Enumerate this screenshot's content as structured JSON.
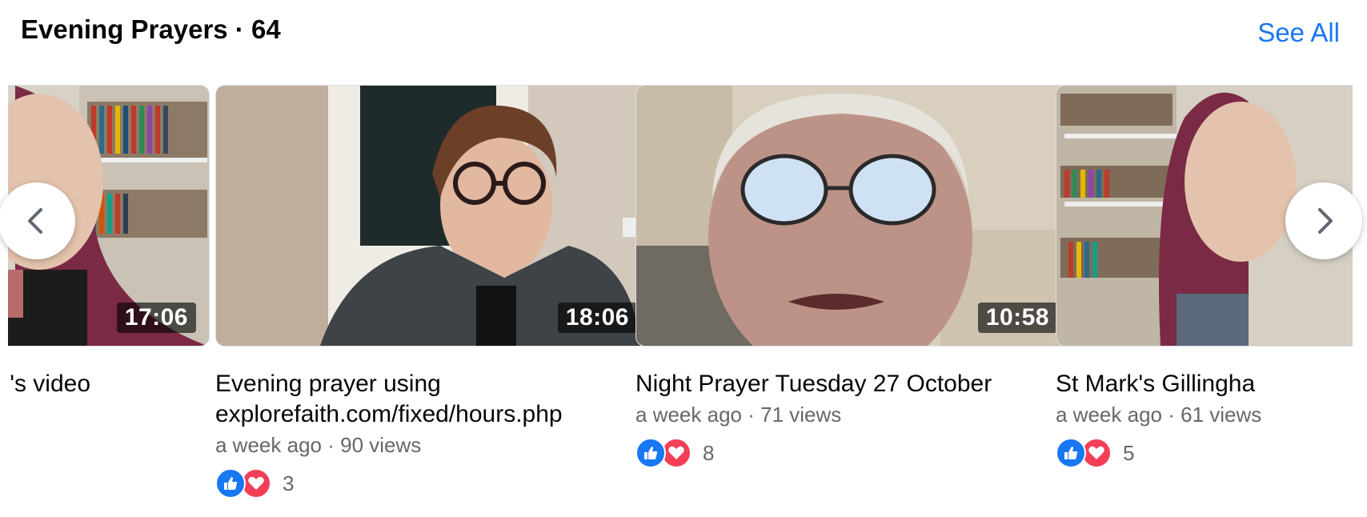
{
  "header": {
    "title": "Evening Prayers · 64",
    "see_all": "See All"
  },
  "colors": {
    "accent": "#1877f2",
    "like": "#1877f2",
    "love": "#f33e58",
    "meta_text": "#65676b"
  },
  "icons": {
    "prev": "chevron-left-icon",
    "next": "chevron-right-icon",
    "like": "thumbs-up-icon",
    "love": "heart-icon"
  },
  "videos": [
    {
      "duration": "17:06",
      "title": "'s video",
      "time_ago": "",
      "views": "",
      "reaction_count": ""
    },
    {
      "duration": "18:06",
      "title": "Evening prayer using explorefaith.com/fixed/hours.php",
      "time_ago": "a week ago",
      "views": "90 views",
      "reaction_count": "3"
    },
    {
      "duration": "10:58",
      "title": "Night Prayer Tuesday 27 October",
      "time_ago": "a week ago",
      "views": "71 views",
      "reaction_count": "8"
    },
    {
      "duration": "",
      "title": "St Mark's Gillingha",
      "time_ago": "a week ago",
      "views": "61 views",
      "reaction_count": "5"
    }
  ]
}
